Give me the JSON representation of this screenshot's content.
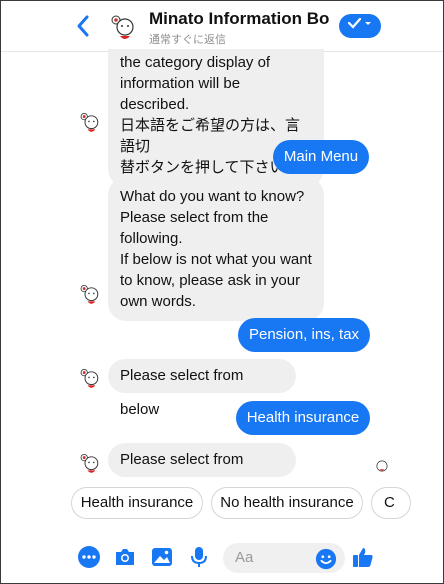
{
  "header": {
    "title": "Minato Information Bo...",
    "subtitle": "通常すぐに返信",
    "back_icon": "chevron-left-icon",
    "check_icon": "checkmark-icon",
    "accent": "#1877f2"
  },
  "messages": [
    {
      "from": "bot",
      "text_lines": [
        "the category display of",
        "information will be described.",
        "日本語をご希望の方は、言語切",
        "替ボタンを押して下さい。"
      ]
    },
    {
      "from": "user",
      "text": "Main Menu"
    },
    {
      "from": "bot",
      "text_lines": [
        "What do you want to know?",
        "Please select from the",
        "following.",
        "If below is not what you want",
        "to know, please  ask in your",
        "own words."
      ]
    },
    {
      "from": "user",
      "text": "Pension, ins, tax"
    },
    {
      "from": "bot",
      "text": "Please select from below"
    },
    {
      "from": "user",
      "text": "Health insurance"
    },
    {
      "from": "bot",
      "text": "Please select from below"
    }
  ],
  "quick_replies": [
    "Health insurance",
    "No health insurance",
    "C"
  ],
  "composer": {
    "placeholder": "Aa",
    "icons": [
      "more-icon",
      "camera-icon",
      "image-icon",
      "microphone-icon",
      "emoji-icon",
      "thumbs-up-icon"
    ]
  }
}
